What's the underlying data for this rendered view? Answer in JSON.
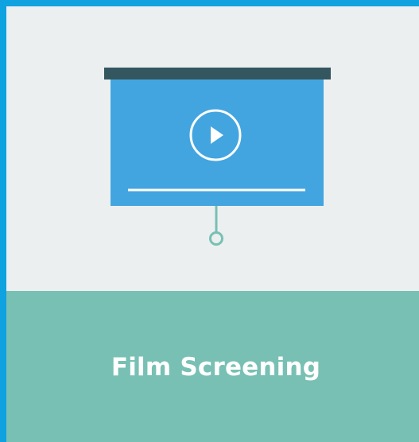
{
  "card": {
    "title": "Film Screening",
    "icon": "projector-screen-icon",
    "play_icon": "play-icon"
  },
  "colors": {
    "border": "#0fa2e0",
    "top_background": "#ebeff0",
    "caption_background": "#78c0b4",
    "screen_fill": "#42a5df",
    "screen_bar": "#34565f",
    "pull_cord": "#78c0b4",
    "caption_text": "#ffffff"
  }
}
